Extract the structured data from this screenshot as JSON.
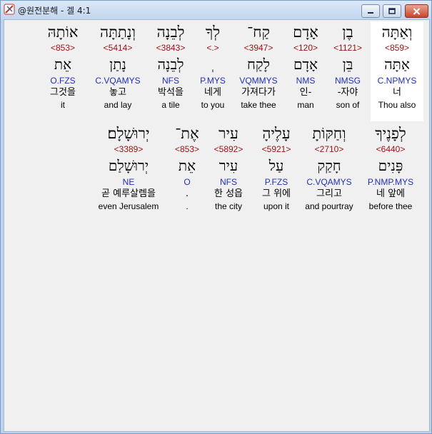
{
  "window": {
    "title": "@원전분해 - 겔 4:1"
  },
  "colors": {
    "strong": "#9a1010",
    "morph": "#2230b8",
    "highlight": "#ffffff"
  },
  "row1": [
    {
      "heb": "וְאַתָּה",
      "strong": "<859>",
      "lemma": "אַתָּה",
      "morph": "C.NPMYS",
      "kor": "너",
      "eng": "Thou also"
    },
    {
      "heb": "בֶן",
      "strong": "<1121>",
      "lemma": "בֵּן",
      "morph": "NMSG",
      "kor": "-자야",
      "eng": "son of"
    },
    {
      "heb": "אָדָם",
      "strong": "<120>",
      "lemma": "אָדָם",
      "morph": "NMS",
      "kor": "인-",
      "eng": "man"
    },
    {
      "heb": "קַח־",
      "strong": "<3947>",
      "lemma": "לָקַח",
      "morph": "VQMMYS",
      "kor": "가져다가",
      "eng": "take thee"
    },
    {
      "heb": "לְךָ",
      "strong": "<.>",
      "lemma": "ְ",
      "morph": "P.MYS",
      "kor": "네게",
      "eng": "to you"
    },
    {
      "heb": "לְבֵנָה",
      "strong": "<3843>",
      "lemma": "לְבֵנָה",
      "morph": "NFS",
      "kor": "박석을",
      "eng": "a tile"
    },
    {
      "heb": "וְנָתַתָּה",
      "strong": "<5414>",
      "lemma": "נָתַן",
      "morph": "C.VQAMYS",
      "kor": "놓고",
      "eng": "and lay"
    },
    {
      "heb": "אוֹתָהּ",
      "strong": "<853>",
      "lemma": "אֵת",
      "morph": "O.FZS",
      "kor": "그것을",
      "eng": "it"
    }
  ],
  "row2": [
    {
      "heb": "לְפָנֶיךָ",
      "strong": "<6440>",
      "lemma": "פָּנִים",
      "morph": "P.NMP.MYS",
      "kor": "네 앞에",
      "eng": "before thee"
    },
    {
      "heb": "וְחַקּוֹתָ",
      "strong": "<2710>",
      "lemma": "חָקַק",
      "morph": "C.VQAMYS",
      "kor": "그리고",
      "eng": "and pourtray"
    },
    {
      "heb": "עָלֶיהָ",
      "strong": "<5921>",
      "lemma": "עַל",
      "morph": "P.FZS",
      "kor": "그 위에",
      "eng": "upon it"
    },
    {
      "heb": "עִיר",
      "strong": "<5892>",
      "lemma": "עִיר",
      "morph": "NFS",
      "kor": "한 성읍",
      "eng": "the city"
    },
    {
      "heb": "אֶת־",
      "strong": "<853>",
      "lemma": "אֵת",
      "morph": "O",
      "kor": ".",
      "eng": "."
    },
    {
      "heb": "יְרוּשָׁלָם׃",
      "strong": "<3389>",
      "lemma": "יְרוּשָׁלַם",
      "morph": "NE",
      "kor": "곧 예루살렘을",
      "eng": "even Jerusalem"
    }
  ]
}
